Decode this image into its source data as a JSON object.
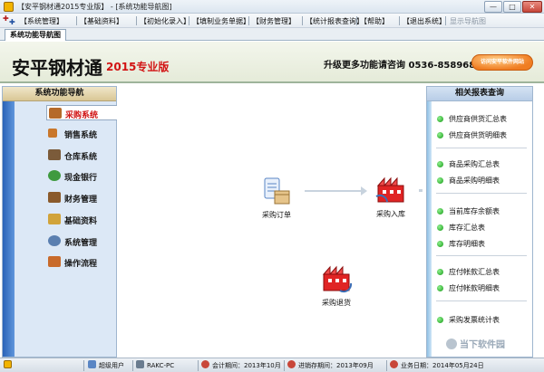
{
  "window": {
    "title": "【安平钢材通2015专业版】 - [系统功能导航图]",
    "minimize_glyph": "—",
    "maximize_glyph": "□",
    "close_glyph": "✕"
  },
  "menu": [
    {
      "label": "【系统管理】"
    },
    {
      "label": "【基础资料】"
    },
    {
      "label": "【初始化录入】"
    },
    {
      "label": "【填制业务单据】"
    },
    {
      "label": "【财务管理】"
    },
    {
      "label": "【统计报表查询】"
    },
    {
      "label": "【帮助】"
    },
    {
      "label": "【退出系统】"
    },
    {
      "label": "显示导航图"
    }
  ],
  "tab": {
    "label": "系统功能导航图"
  },
  "banner": {
    "brand": "安平钢材通",
    "edition": "2015专业版",
    "hotline": "升级更多功能请咨询 0536-8589685",
    "visit_button": "访问安平软件网站"
  },
  "nav": {
    "header": "系统功能导航",
    "items": [
      {
        "label": "采购系统",
        "icon": "truck-icon",
        "color": "#b56a2a"
      },
      {
        "label": "销售系统",
        "icon": "pen-icon",
        "color": "#c9772b"
      },
      {
        "label": "仓库系统",
        "icon": "warehouse-icon",
        "color": "#7b5b3a"
      },
      {
        "label": "现金银行",
        "icon": "cash-icon",
        "color": "#3f9a3f"
      },
      {
        "label": "财务管理",
        "icon": "wallet-icon",
        "color": "#8a5a2b"
      },
      {
        "label": "基础资料",
        "icon": "folder-icon",
        "color": "#d1a33a"
      },
      {
        "label": "系统管理",
        "icon": "gear-icon",
        "color": "#5a7fb0"
      },
      {
        "label": "操作流程",
        "icon": "book-icon",
        "color": "#c86a2b"
      }
    ]
  },
  "flow": {
    "purchase_order": "采购订单",
    "purchase_in": "采购入库",
    "purchase_return": "采购退货"
  },
  "reports": {
    "header": "相关报表查询",
    "groups": [
      [
        "供应商供货汇总表",
        "供应商供货明细表"
      ],
      [
        "商品采购汇总表",
        "商品采购明细表"
      ],
      [
        "当前库存余额表",
        "库存汇总表",
        "库存明细表"
      ],
      [
        "应付帐款汇总表",
        "应付帐款明细表"
      ],
      [
        "采购发票统计表"
      ]
    ]
  },
  "status": {
    "user": "超级用户",
    "host": "RAKC-PC",
    "accounting_period": "会计期间：2013年10月",
    "inventory_period": "进销存期间：2013年09月",
    "business_date": "业务日期：2014年05月24日"
  },
  "watermark": "当下软件园"
}
